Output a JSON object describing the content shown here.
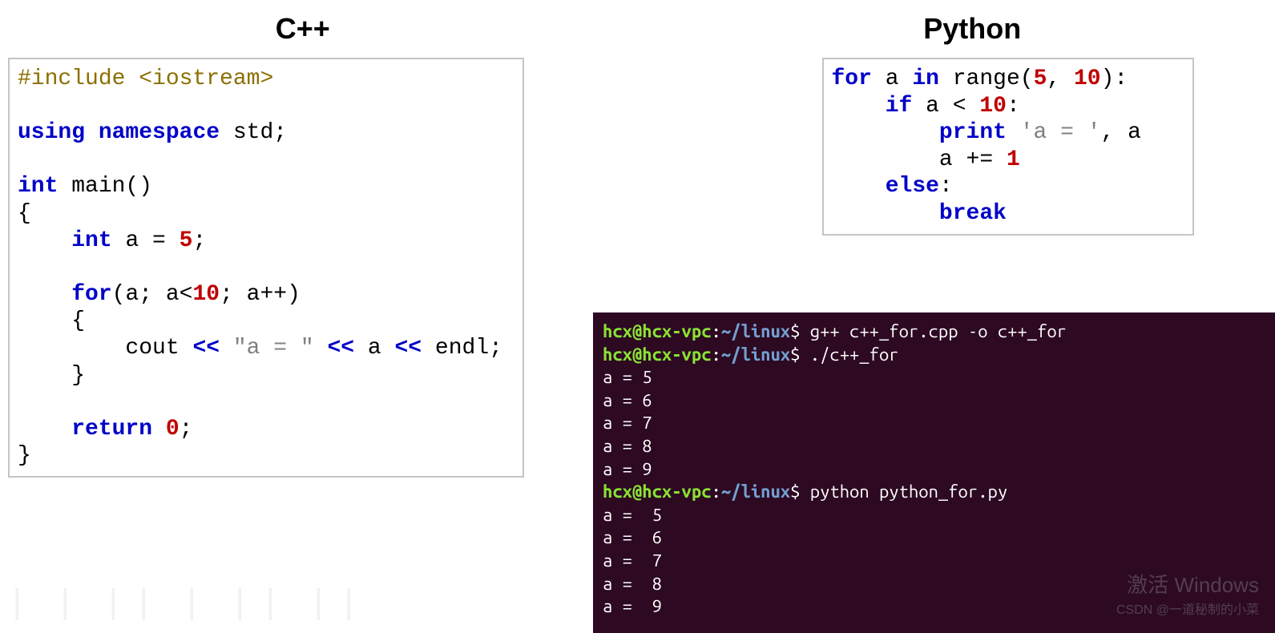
{
  "headings": {
    "cpp": "C++",
    "python": "Python"
  },
  "cpp_code": {
    "l1_include": "#include <iostream>",
    "l3_using": "using",
    "l3_namespace": "namespace",
    "l3_std": " std;",
    "l5_int": "int",
    "l5_main": " main()",
    "l6_brace": "{",
    "l7_indent": "    ",
    "l7_int": "int",
    "l7_rest": " a = ",
    "l7_num": "5",
    "l7_semi": ";",
    "l9_indent": "    ",
    "l9_for": "for",
    "l9_open": "(a; a<",
    "l9_num": "10",
    "l9_close": "; a++)",
    "l10": "    {",
    "l11_indent": "        cout ",
    "l11_op1": "<<",
    "l11_str": " \"a = \" ",
    "l11_op2": "<<",
    "l11_a": " a ",
    "l11_op3": "<<",
    "l11_endl": " endl;",
    "l12": "    }",
    "l14_indent": "    ",
    "l14_return": "return",
    "l14_val": " ",
    "l14_num": "0",
    "l14_semi": ";",
    "l15": "}"
  },
  "py_code": {
    "l1_for": "for",
    "l1_a": " a ",
    "l1_in": "in",
    "l1_range": " range(",
    "l1_5": "5",
    "l1_c": ", ",
    "l1_10": "10",
    "l1_end": "):",
    "l2_indent": "    ",
    "l2_if": "if",
    "l2_cond": " a < ",
    "l2_num": "10",
    "l2_colon": ":",
    "l3_indent": "        ",
    "l3_print": "print",
    "l3_str": " 'a = '",
    "l3_rest": ", a",
    "l4": "        a += ",
    "l4_num": "1",
    "l5_indent": "    ",
    "l5_else": "else",
    "l5_colon": ":",
    "l6_indent": "        ",
    "l6_break": "break"
  },
  "terminal": {
    "user": "hcx@hcx-vpc",
    "colon": ":",
    "path": "~/linux",
    "dollar": "$ ",
    "cmd1": "g++ c++_for.cpp -o c++_for",
    "cmd2": "./c++_for",
    "out_cpp": [
      "a = 5",
      "a = 6",
      "a = 7",
      "a = 8",
      "a = 9"
    ],
    "cmd3": "python python_for.py",
    "out_py": [
      "a =  5",
      "a =  6",
      "a =  7",
      "a =  8",
      "a =  9"
    ]
  },
  "watermark": {
    "line1": "激活 Windows",
    "line2": "CSDN @一道秘制的小菜"
  },
  "bars": "⎸ ⎸ ⎸⎸     ⎸ ⎸⎸ ⎸⎸"
}
